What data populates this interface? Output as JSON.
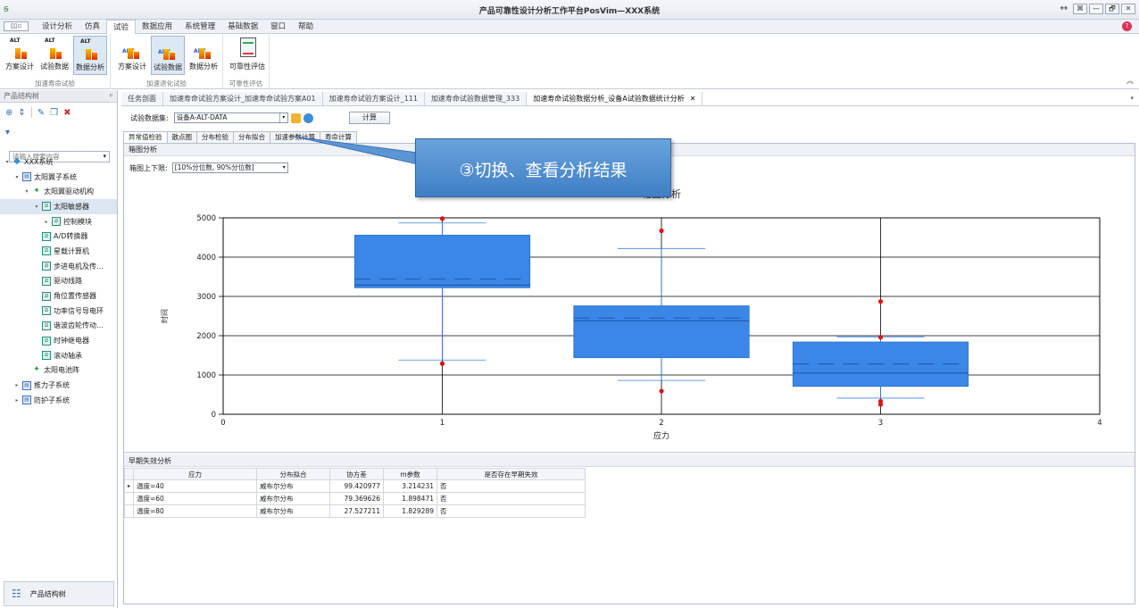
{
  "window": {
    "title": "产品可靠性设计分析工作平台PosVim—XXX系统",
    "buttons": [
      "⌘",
      "—",
      "🗗",
      "✕"
    ]
  },
  "menu": {
    "file": "▯▯▫",
    "tabs": [
      "设计分析",
      "仿真",
      "试验",
      "数据应用",
      "系统管理",
      "基础数据",
      "窗口",
      "帮助"
    ],
    "active": 2
  },
  "ribbon": {
    "groups": [
      {
        "name": "加速寿命试验",
        "buttons": [
          "方案设计",
          "试验数据",
          "数据分析"
        ]
      },
      {
        "name": "加速退化试验",
        "buttons": [
          "方案设计",
          "试验数据",
          "数据分析"
        ]
      },
      {
        "name": "可靠性评估",
        "buttons": [
          "可靠性评估"
        ]
      }
    ],
    "tag_alt": "ALT",
    "tag_adt": "ADT"
  },
  "left_panel": {
    "title": "产品结构树",
    "pin": "ᵖ",
    "search_placeholder": "请输入搜索内容",
    "tree": [
      {
        "label": "XXX系统",
        "level": 0,
        "toggle": "▾",
        "icon": "root"
      },
      {
        "label": "太阳翼子系统",
        "level": 1,
        "toggle": "▾",
        "icon": "sys"
      },
      {
        "label": "太阳翼驱动机构",
        "level": 2,
        "toggle": "▾",
        "icon": "mod"
      },
      {
        "label": "太阳敏感器",
        "level": 3,
        "toggle": "▾",
        "icon": "part",
        "selected": true
      },
      {
        "label": "控制模块",
        "level": 4,
        "toggle": "▸",
        "icon": "part"
      },
      {
        "label": "A/D转换器",
        "level": 3,
        "toggle": "",
        "icon": "part"
      },
      {
        "label": "星载计算机",
        "level": 3,
        "toggle": "",
        "icon": "part"
      },
      {
        "label": "步进电机及传…",
        "level": 3,
        "toggle": "",
        "icon": "part"
      },
      {
        "label": "驱动线路",
        "level": 3,
        "toggle": "",
        "icon": "part"
      },
      {
        "label": "角位置传感器",
        "level": 3,
        "toggle": "",
        "icon": "part"
      },
      {
        "label": "功率信号导电环",
        "level": 3,
        "toggle": "",
        "icon": "part"
      },
      {
        "label": "谐波齿轮传动…",
        "level": 3,
        "toggle": "",
        "icon": "part"
      },
      {
        "label": "时钟继电器",
        "level": 3,
        "toggle": "",
        "icon": "part"
      },
      {
        "label": "滚动轴承",
        "level": 3,
        "toggle": "",
        "icon": "part"
      },
      {
        "label": "太阳电池阵",
        "level": 2,
        "toggle": "",
        "icon": "mod"
      },
      {
        "label": "推力子系统",
        "level": 1,
        "toggle": "▸",
        "icon": "sys"
      },
      {
        "label": "防护子系统",
        "level": 1,
        "toggle": "▸",
        "icon": "sys"
      }
    ],
    "bottom_label": "产品结构树"
  },
  "doc_tabs": [
    {
      "label": "任务剖面",
      "active": false
    },
    {
      "label": "加速寿命试验方案设计_加速寿命试验方案A01",
      "active": false
    },
    {
      "label": "加速寿命试验方案设计_111",
      "active": false
    },
    {
      "label": "加速寿命试验数据管理_333",
      "active": false
    },
    {
      "label": "加速寿命试验数据分析_设备A试验数据统计分析",
      "active": true,
      "close": "✕"
    }
  ],
  "dataset": {
    "label": "试验数据集:",
    "value": "设备A-ALT-DATA",
    "calc_button": "计算"
  },
  "sub_tabs": [
    "异常值检验",
    "散点图",
    "分布检验",
    "分布拟合",
    "加速参数计算",
    "寿命计算"
  ],
  "boxplot_section": {
    "title": "箱图分析",
    "limit_label": "箱图上下限:",
    "limit_value": "[10%分位数, 90%分位数]"
  },
  "callout": "③切换、查看分析结果",
  "chart_data": {
    "type": "boxplot",
    "title": "箱图分析",
    "xlabel": "应力",
    "ylabel": "时间",
    "xlim": [
      0,
      4
    ],
    "ylim": [
      0,
      5000
    ],
    "x_ticks": [
      0,
      1,
      2,
      3,
      4
    ],
    "y_ticks": [
      0,
      1000,
      2000,
      3000,
      4000,
      5000
    ],
    "grid": true,
    "box_color": "#3b87e8",
    "outlier_color": "#e01010",
    "boxes": [
      {
        "x": 1,
        "lower_whisker": 1380,
        "q1": 3220,
        "median": 3290,
        "mean": 3440,
        "q3": 4560,
        "upper_whisker": 4870,
        "outliers": [
          1290,
          4980
        ]
      },
      {
        "x": 2,
        "lower_whisker": 860,
        "q1": 1440,
        "median": 2380,
        "mean": 2450,
        "q3": 2760,
        "upper_whisker": 4220,
        "outliers": [
          590,
          4670
        ]
      },
      {
        "x": 3,
        "lower_whisker": 410,
        "q1": 710,
        "median": 1050,
        "mean": 1280,
        "q3": 1840,
        "upper_whisker": 1970,
        "outliers": [
          250,
          330,
          1960,
          2870
        ]
      }
    ]
  },
  "early_failure": {
    "title": "早期失效分析",
    "columns": [
      "应力",
      "分布拟合",
      "协方差",
      "m参数",
      "是否存在早期失效"
    ],
    "rows": [
      [
        "温度=40",
        "威布尔分布",
        "99.420977",
        "3.214231",
        "否"
      ],
      [
        "温度=60",
        "威布尔分布",
        "79.369626",
        "1.898471",
        "否"
      ],
      [
        "温度=80",
        "威布尔分布",
        "27.527211",
        "1.829289",
        "否"
      ]
    ]
  }
}
